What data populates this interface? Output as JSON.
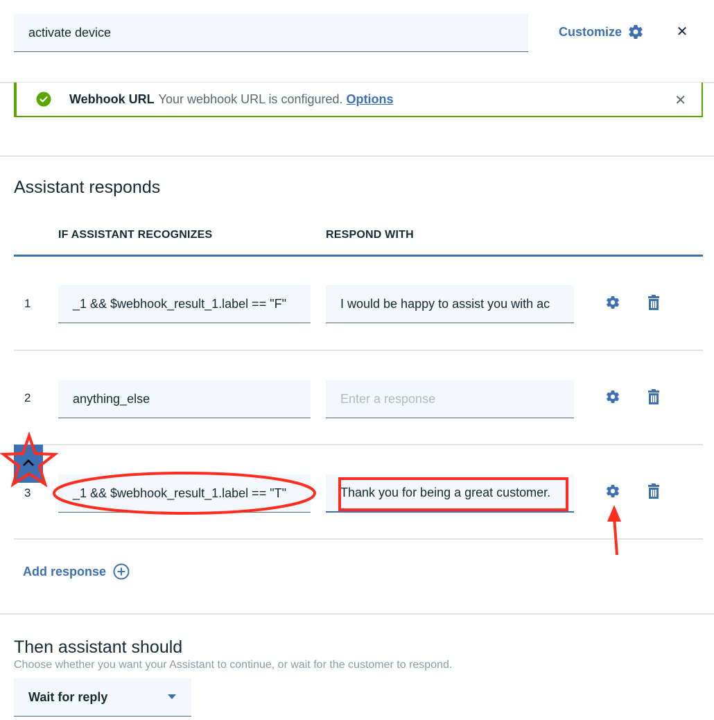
{
  "header": {
    "name_value": "activate device",
    "customize_label": "Customize",
    "close_label": "✕"
  },
  "notification": {
    "title": "Webhook URL",
    "message": "Your webhook URL is configured.",
    "link_label": "Options",
    "close_label": "✕",
    "status_color": "#5aa700"
  },
  "assistant_responds": {
    "heading": "Assistant responds",
    "col_condition": "IF ASSISTANT RECOGNIZES",
    "col_response": "RESPOND WITH",
    "rows": [
      {
        "num": "1",
        "condition": "_1 && $webhook_result_1.label == \"F\"",
        "response": "I would be happy to assist you with ac",
        "response_placeholder": ""
      },
      {
        "num": "2",
        "condition": "anything_else",
        "response": "",
        "response_placeholder": "Enter a response"
      },
      {
        "num": "3",
        "condition": "_1 && $webhook_result_1.label == \"T\"",
        "response": "Thank you for being a great customer.",
        "response_placeholder": ""
      }
    ],
    "add_response_label": "Add response"
  },
  "then_assistant": {
    "heading": "Then assistant should",
    "description": "Choose whether you want your Assistant to continue, or wait for the customer to respond.",
    "selected": "Wait for reply"
  },
  "colors": {
    "accent": "#3d70b2",
    "text": "#152935",
    "field_bg": "#f4f7fb",
    "annotation": "#ff2d1f"
  }
}
